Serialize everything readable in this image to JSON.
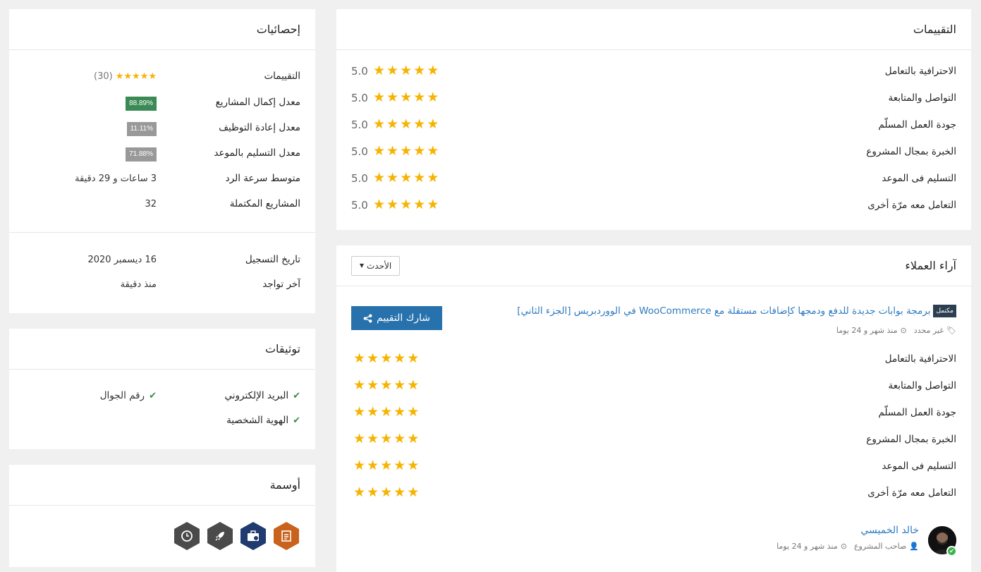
{
  "ratings_panel": {
    "title": "التقييمات",
    "rows": [
      {
        "label": "الاحترافية بالتعامل",
        "score": "5.0"
      },
      {
        "label": "التواصل والمتابعة",
        "score": "5.0"
      },
      {
        "label": "جودة العمل المسلّم",
        "score": "5.0"
      },
      {
        "label": "الخبرة بمجال المشروع",
        "score": "5.0"
      },
      {
        "label": "التسليم فى الموعد",
        "score": "5.0"
      },
      {
        "label": "التعامل معه مرّة أخرى",
        "score": "5.0"
      }
    ],
    "stars_filled": 5
  },
  "reviews_panel": {
    "title": "آراء العملاء",
    "sort_label": "الأحدث",
    "share_label": "شارك التقييم",
    "project": {
      "status_tag": "مكتمل",
      "title": "برمجة بوابات جديدة للدفع ودمجها كإضافات مستقلة مع WooCommerce في الووردبريس [الجزء الثاني]",
      "category": "غير محدد",
      "time_ago": "منذ شهر و 24 يوما"
    },
    "criteria": [
      "الاحترافية بالتعامل",
      "التواصل والمتابعة",
      "جودة العمل المسلّم",
      "الخبرة بمجال المشروع",
      "التسليم فى الموعد",
      "التعامل معه مرّة أخرى"
    ],
    "reviewer": {
      "name": "خالد الخميسي",
      "role": "صاحب المشروع",
      "time_ago": "منذ شهر و 24 يوما"
    }
  },
  "stats_panel": {
    "title": "إحصائيات",
    "ratings_label": "التقييمات",
    "ratings_count": "(30)",
    "completion_label": "معدل إكمال المشاريع",
    "completion_value": "88.89%",
    "rehire_label": "معدل إعادة التوظيف",
    "rehire_value": "11.11%",
    "ontime_label": "معدل التسليم بالموعد",
    "ontime_value": "71.88%",
    "response_label": "متوسط سرعة الرد",
    "response_value": "3 ساعات و 29 دقيقة",
    "completed_label": "المشاريع المكتملة",
    "completed_value": "32",
    "registered_label": "تاريخ التسجيل",
    "registered_value": "16 ديسمبر 2020",
    "last_seen_label": "آخر تواجد",
    "last_seen_value": "منذ دقيقة"
  },
  "verifications_panel": {
    "title": "توثيقات",
    "email": "البريد الإلكتروني",
    "phone": "رقم الجوال",
    "identity": "الهوية الشخصية"
  },
  "badges_panel": {
    "title": "أوسمة",
    "badges": [
      {
        "icon": "notepad-icon",
        "color": "#c9621c"
      },
      {
        "icon": "briefcase-icon",
        "color": "#1f3b6f"
      },
      {
        "icon": "rocket-icon",
        "color": "#4a4a4a"
      },
      {
        "icon": "clock-icon",
        "color": "#4a4a4a"
      }
    ]
  },
  "colors": {
    "link": "#2f7bbf",
    "star": "#f6b300",
    "badge_green": "#3a8a55",
    "badge_gray": "#999999",
    "share_button": "#2772ad"
  }
}
